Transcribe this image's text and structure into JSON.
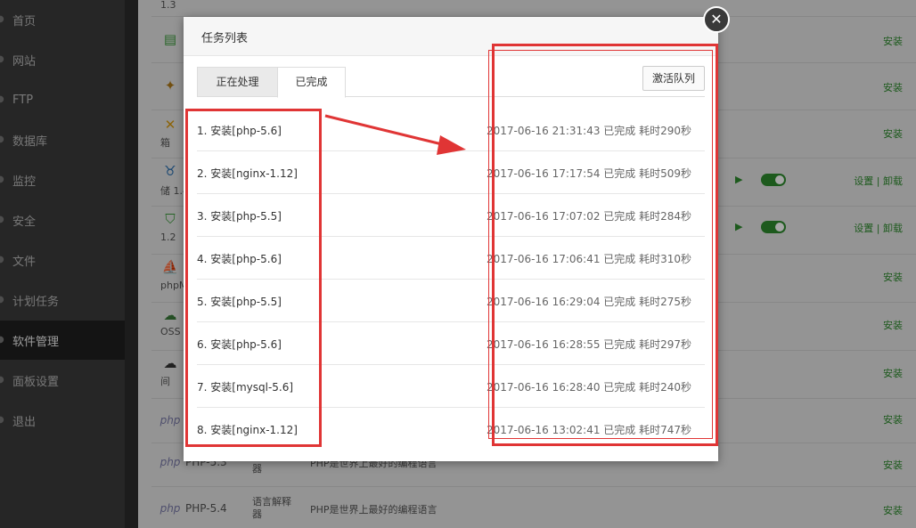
{
  "sidebar": {
    "items": [
      {
        "label": "首页"
      },
      {
        "label": "网站"
      },
      {
        "label": "FTP"
      },
      {
        "label": "数据库"
      },
      {
        "label": "监控"
      },
      {
        "label": "安全"
      },
      {
        "label": "文件"
      },
      {
        "label": "计划任务"
      },
      {
        "label": "软件管理"
      },
      {
        "label": "面板设置"
      },
      {
        "label": "退出"
      }
    ],
    "active_index": 8
  },
  "software_rows": [
    {
      "sub": "1.3",
      "action": ""
    },
    {
      "icon": "clipboard-icon",
      "action": "安装"
    },
    {
      "icon": "tomcat-icon",
      "action": "安装"
    },
    {
      "icon": "tools-icon",
      "sub": "箱",
      "action": "安装"
    },
    {
      "icon": "bull-icon",
      "sub": "储 1.4",
      "action": "设置 | 卸载"
    },
    {
      "icon": "php-shield-icon",
      "sub": "1.2",
      "action": "设置 | 卸载"
    },
    {
      "icon": "sailboat-icon",
      "sub": "phpM",
      "action": "安装"
    },
    {
      "icon": "oss-icon",
      "sub": "OSS",
      "action": "安装"
    },
    {
      "icon": "ftp-cloud-icon",
      "sub": "间",
      "action": "安装"
    },
    {
      "icon": "php-logo-icon",
      "action": "安装"
    },
    {
      "icon": "php-logo-icon",
      "name": "PHP-5.3",
      "type": "器",
      "desc": "PHP是世界上最好的编程语言",
      "action": "安装"
    },
    {
      "icon": "php-logo-icon",
      "name": "PHP-5.4",
      "type": "语言解释器",
      "desc": "PHP是世界上最好的编程语言",
      "action": "安装"
    }
  ],
  "modal": {
    "title": "任务列表",
    "tabs": {
      "processing": "正在处理",
      "completed": "已完成"
    },
    "activate_button": "激活队列",
    "tasks": [
      {
        "label": "1. 安装[php-5.6]",
        "status": "2017-06-16 21:31:43 已完成 耗时290秒"
      },
      {
        "label": "2. 安装[nginx-1.12]",
        "status": "2017-06-16 17:17:54 已完成 耗时509秒"
      },
      {
        "label": "3. 安装[php-5.5]",
        "status": "2017-06-16 17:07:02 已完成 耗时284秒"
      },
      {
        "label": "4. 安装[php-5.6]",
        "status": "2017-06-16 17:06:41 已完成 耗时310秒"
      },
      {
        "label": "5. 安装[php-5.5]",
        "status": "2017-06-16 16:29:04 已完成 耗时275秒"
      },
      {
        "label": "6. 安装[php-5.6]",
        "status": "2017-06-16 16:28:55 已完成 耗时297秒"
      },
      {
        "label": "7. 安装[mysql-5.6]",
        "status": "2017-06-16 16:28:40 已完成 耗时240秒"
      },
      {
        "label": "8. 安装[nginx-1.12]",
        "status": "2017-06-16 13:02:41 已完成 耗时747秒"
      }
    ]
  },
  "colors": {
    "annotation": "#e03535",
    "install_green": "#2d8a2d",
    "sidebar_bg": "#3b3b3b"
  }
}
